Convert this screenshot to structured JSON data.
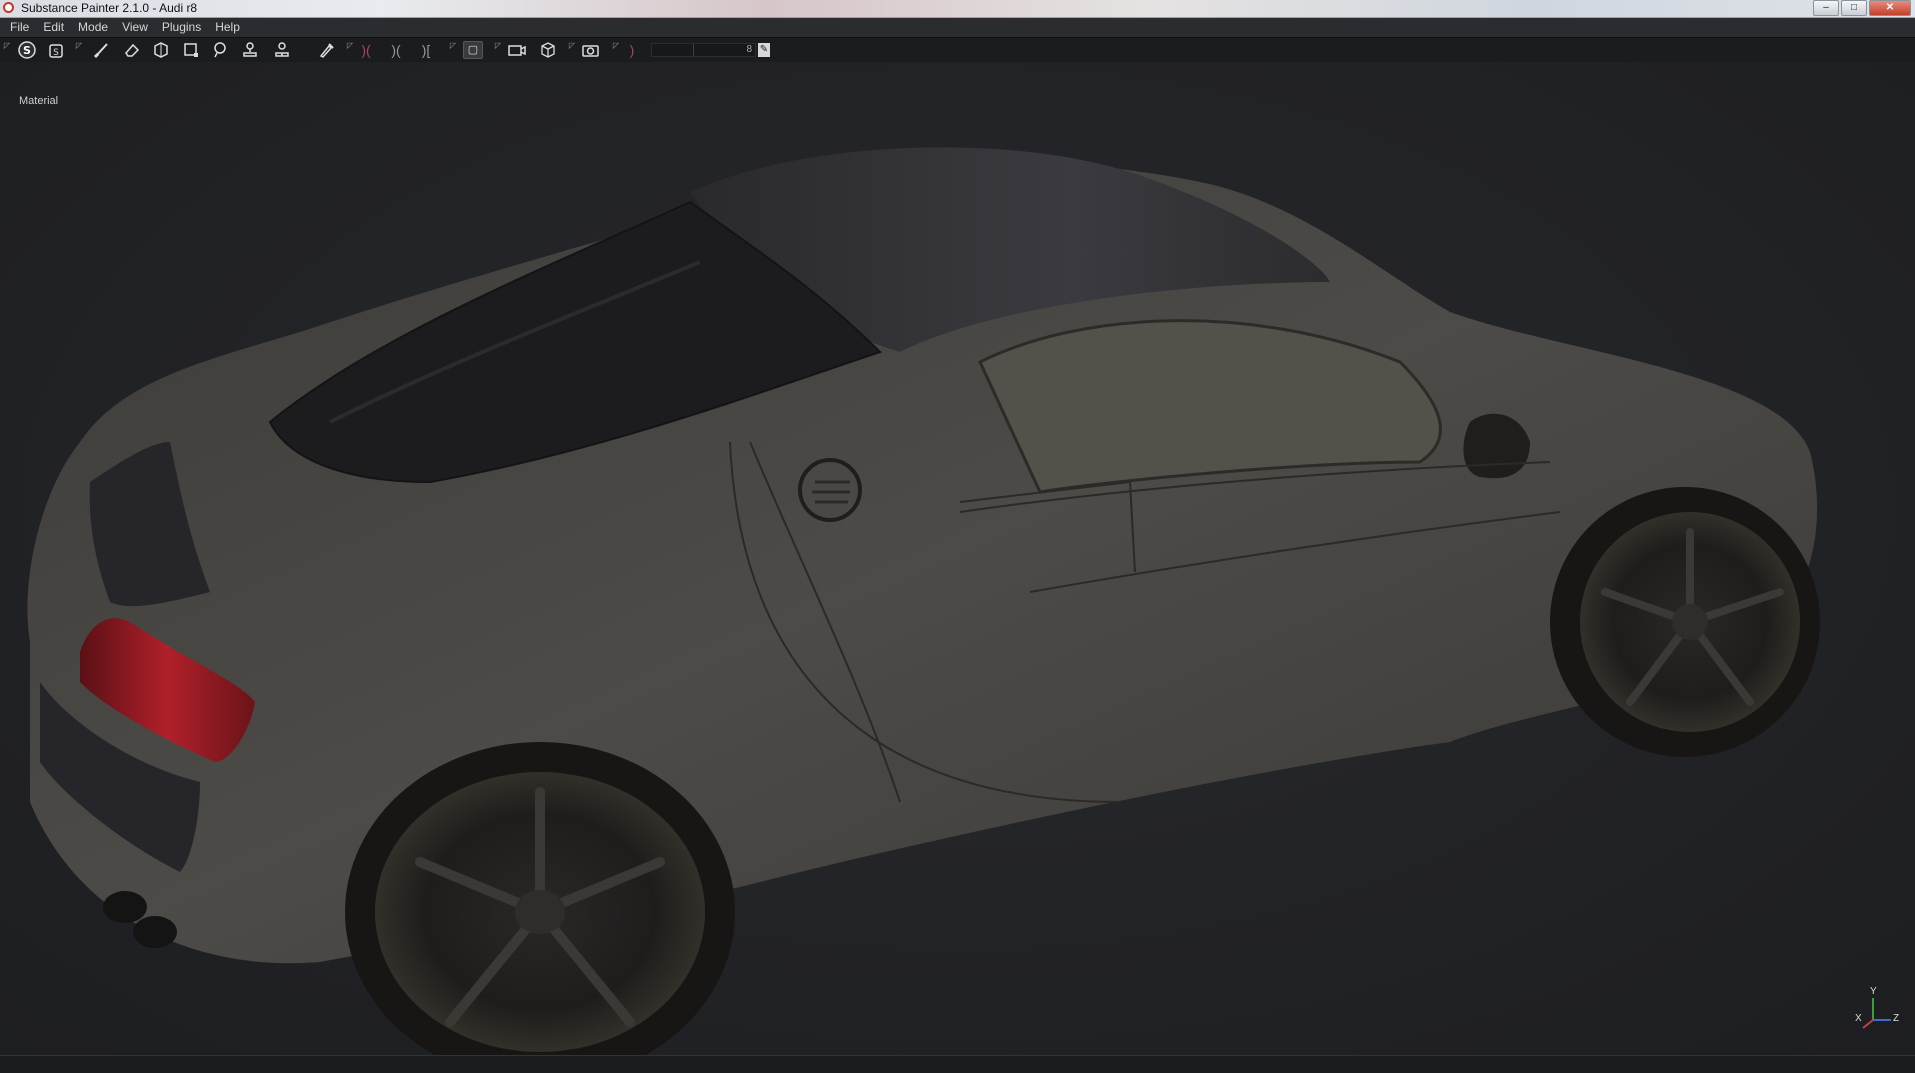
{
  "window": {
    "title": "Substance Painter 2.1.0 - Audi r8",
    "controls": {
      "minimize": "–",
      "maximize": "□",
      "close": "✕"
    }
  },
  "menubar": {
    "items": [
      "File",
      "Edit",
      "Mode",
      "View",
      "Plugins",
      "Help"
    ]
  },
  "toolbar": {
    "icons": [
      "substance-logo-icon",
      "bake-icon",
      "paint-brush-icon",
      "eraser-icon",
      "projection-icon",
      "polygon-fill-icon",
      "smudge-icon",
      "clone-stamp-icon",
      "material-picker-icon",
      "color-picker-icon",
      "symmetry-icons",
      "camera-view-icon",
      "camera-icon",
      "render-cube-icon",
      "screenshot-icon"
    ],
    "slider_value": "8"
  },
  "viewport": {
    "label": "Material",
    "axis": {
      "y": "Y",
      "x": "X",
      "z": "Z"
    },
    "colors": {
      "background": "#222326",
      "car_body": "#4b4945",
      "tail_light": "#b0202a"
    }
  }
}
